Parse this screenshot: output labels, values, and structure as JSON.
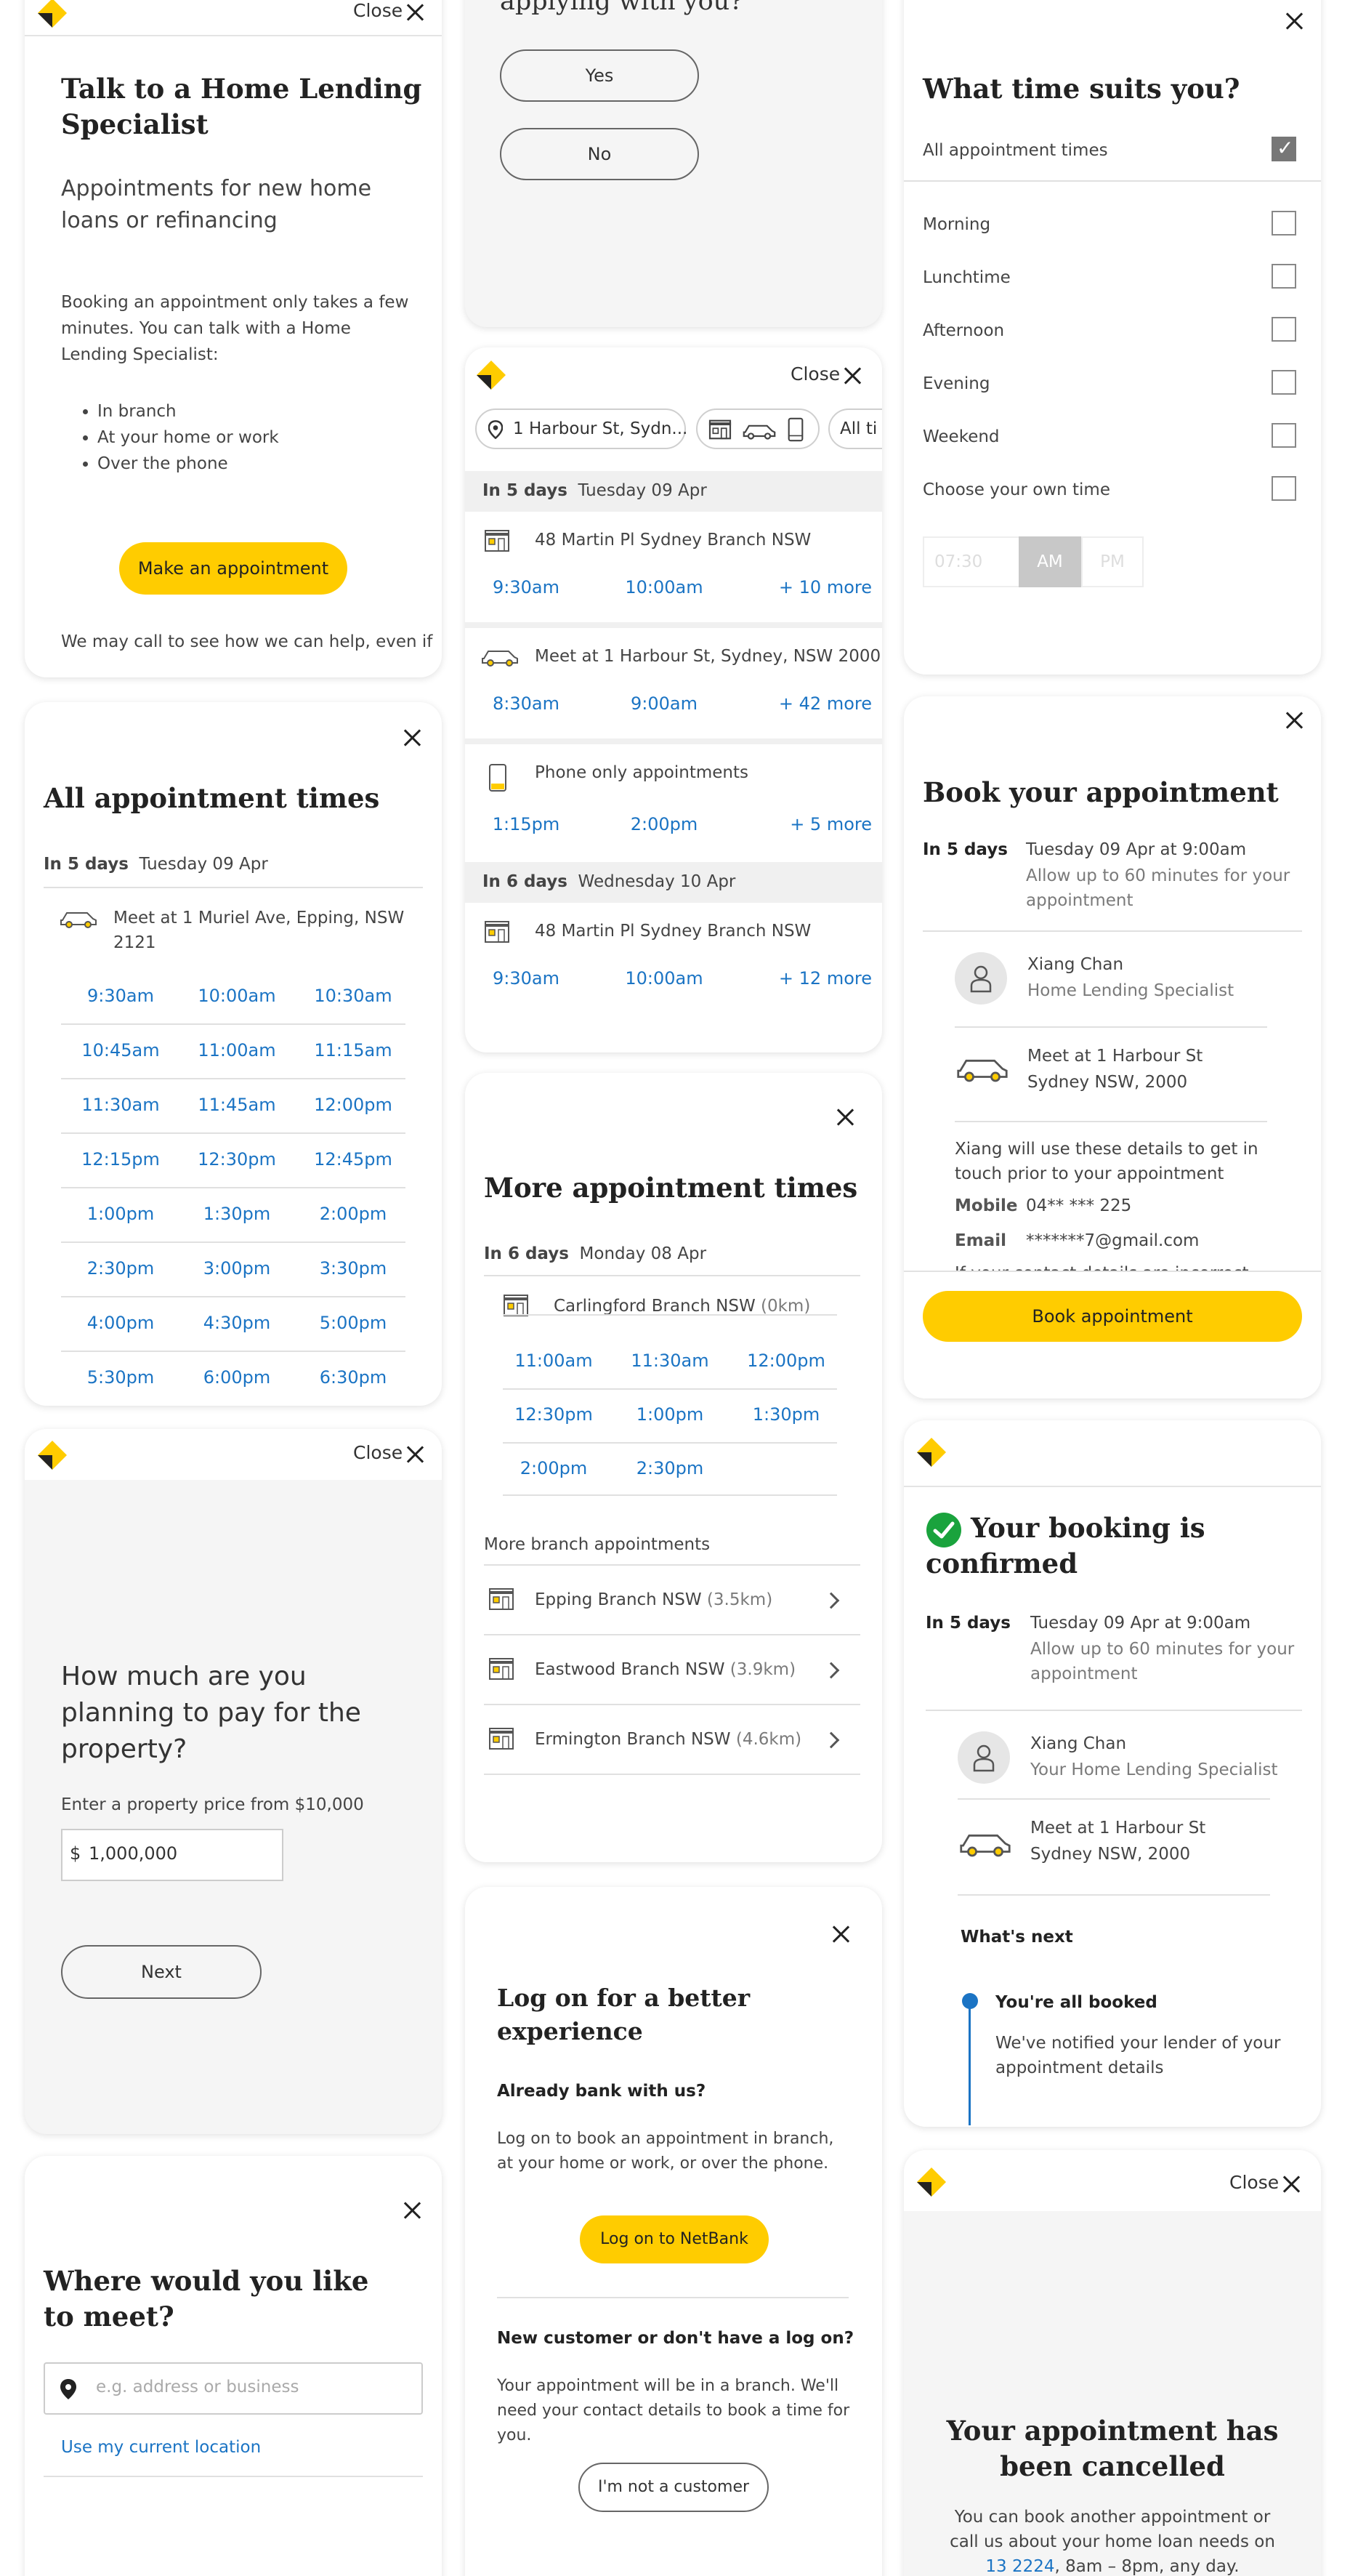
{
  "common": {
    "close_label": "Close"
  },
  "intro": {
    "title": "Talk to a Home Lending Specialist",
    "subtitle": "Appointments for new home loans or refinancing",
    "body": "Booking an appointment only takes a few minutes. You can talk with a Home Lending Specialist:",
    "bullets": [
      "In branch",
      "At your home or work",
      "Over the phone"
    ],
    "cta": "Make an appointment",
    "footer": "We may call to see how we can help, even if"
  },
  "all_times": {
    "title": "All appointment times",
    "days_label": "In 5 days",
    "date": "Tuesday 09 Apr",
    "location": "Meet at 1 Muriel Ave, Epping, NSW 2121",
    "times": [
      [
        "9:30am",
        "10:00am",
        "10:30am"
      ],
      [
        "10:45am",
        "11:00am",
        "11:15am"
      ],
      [
        "11:30am",
        "11:45am",
        "12:00pm"
      ],
      [
        "12:15pm",
        "12:30pm",
        "12:45pm"
      ],
      [
        "1:00pm",
        "1:30pm",
        "2:00pm"
      ],
      [
        "2:30pm",
        "3:00pm",
        "3:30pm"
      ],
      [
        "4:00pm",
        "4:30pm",
        "5:00pm"
      ],
      [
        "5:30pm",
        "6:00pm",
        "6:30pm"
      ]
    ]
  },
  "price": {
    "question": "How much are you planning to pay for the property?",
    "hint": "Enter a property price from $10,000",
    "currency": "$",
    "value": "1,000,000",
    "next": "Next"
  },
  "meet": {
    "title": "Where would you like to meet?",
    "placeholder": "e.g. address or business",
    "use_location": "Use my current location"
  },
  "applying": {
    "title_partial": "applying with you?",
    "yes": "Yes",
    "no": "No"
  },
  "results": {
    "filter_location": "1 Harbour St, Sydn...",
    "filter_times": "All ti",
    "groups": [
      {
        "days_label": "In 5 days",
        "date": "Tuesday 09 Apr",
        "items": [
          {
            "kind": "branch",
            "label": "48 Martin Pl Sydney Branch NSW",
            "times": [
              "9:30am",
              "10:00am"
            ],
            "more": "+ 10 more"
          },
          {
            "kind": "car",
            "label": "Meet at 1 Harbour St, Sydney, NSW 2000",
            "times": [
              "8:30am",
              "9:00am"
            ],
            "more": "+ 42 more"
          },
          {
            "kind": "phone",
            "label": "Phone only appointments",
            "times": [
              "1:15pm",
              "2:00pm"
            ],
            "more": "+ 5 more"
          }
        ]
      },
      {
        "days_label": "In 6 days",
        "date": "Wednesday 10 Apr",
        "items": [
          {
            "kind": "branch",
            "label": "48 Martin Pl Sydney Branch NSW",
            "times": [
              "9:30am",
              "10:00am"
            ],
            "more": "+ 12 more"
          }
        ]
      }
    ]
  },
  "more_times": {
    "title": "More appointment times",
    "days_label": "In 6 days",
    "date": "Monday 08 Apr",
    "branch": "Carlingford Branch NSW",
    "branch_dist": "(0km)",
    "times": [
      [
        "11:00am",
        "11:30am",
        "12:00pm"
      ],
      [
        "12:30pm",
        "1:00pm",
        "1:30pm"
      ],
      [
        "2:00pm",
        "2:30pm",
        ""
      ]
    ],
    "more_label": "More branch appointments",
    "branches": [
      {
        "name": "Epping Branch NSW",
        "dist": "(3.5km)"
      },
      {
        "name": "Eastwood Branch NSW",
        "dist": "(3.9km)"
      },
      {
        "name": "Ermington Branch NSW",
        "dist": "(4.6km)"
      }
    ]
  },
  "logon": {
    "title": "Log on for a better experience",
    "already": "Already bank with us?",
    "already_body": "Log on to book an appointment in branch, at your home or work, or over the phone.",
    "netbank": "Log on to NetBank",
    "new_customer": "New customer or don't have a log on?",
    "new_body": "Your appointment will be in a branch. We'll need your contact details to book a time for you.",
    "not_customer": "I'm not a customer"
  },
  "time_suits": {
    "title": "What time suits you?",
    "options": [
      {
        "label": "All appointment times",
        "checked": true
      },
      {
        "label": "Morning",
        "checked": false
      },
      {
        "label": "Lunchtime",
        "checked": false
      },
      {
        "label": "Afternoon",
        "checked": false
      },
      {
        "label": "Evening",
        "checked": false
      },
      {
        "label": "Weekend",
        "checked": false
      },
      {
        "label": "Choose your own time",
        "checked": false
      }
    ],
    "time_value": "07:30",
    "am": "AM",
    "pm": "PM"
  },
  "book": {
    "title": "Book your appointment",
    "days_label": "In 5 days",
    "date": "Tuesday 09 Apr at 9:00am",
    "duration": "Allow up to 60 minutes for your appointment",
    "name": "Xiang Chan",
    "role": "Home Lending Specialist",
    "location_line1": "Meet at 1 Harbour St",
    "location_line2": "Sydney NSW, 2000",
    "contact_note": "Xiang will use these details to get in touch prior to your appointment",
    "mobile_label": "Mobile",
    "mobile": "04** *** 225",
    "email_label": "Email",
    "email": "*******7@gmail.com",
    "cut_text": "If your contact details are incorrect",
    "cta": "Book appointment"
  },
  "confirmed": {
    "title": "Your booking is confirmed",
    "days_label": "In 5 days",
    "date": "Tuesday 09 Apr at 9:00am",
    "duration": "Allow up to 60 minutes for your appointment",
    "name": "Xiang Chan",
    "role": "Your Home Lending Specialist",
    "location_line1": "Meet at 1 Harbour St",
    "location_line2": "Sydney NSW, 2000",
    "whats_next": "What's next",
    "step_title": "You're all booked",
    "step_body": "We've notified your lender of your appointment details"
  },
  "cancelled": {
    "title": "Your appointment has been cancelled",
    "body_pre": "You can book another appointment or call us about your home loan needs on",
    "phone": "13 2224",
    "hours": "8am – 8pm, any day."
  },
  "colors": {
    "accent": "#ffcc00",
    "link": "#1b74c4",
    "success": "#1aa33d"
  }
}
